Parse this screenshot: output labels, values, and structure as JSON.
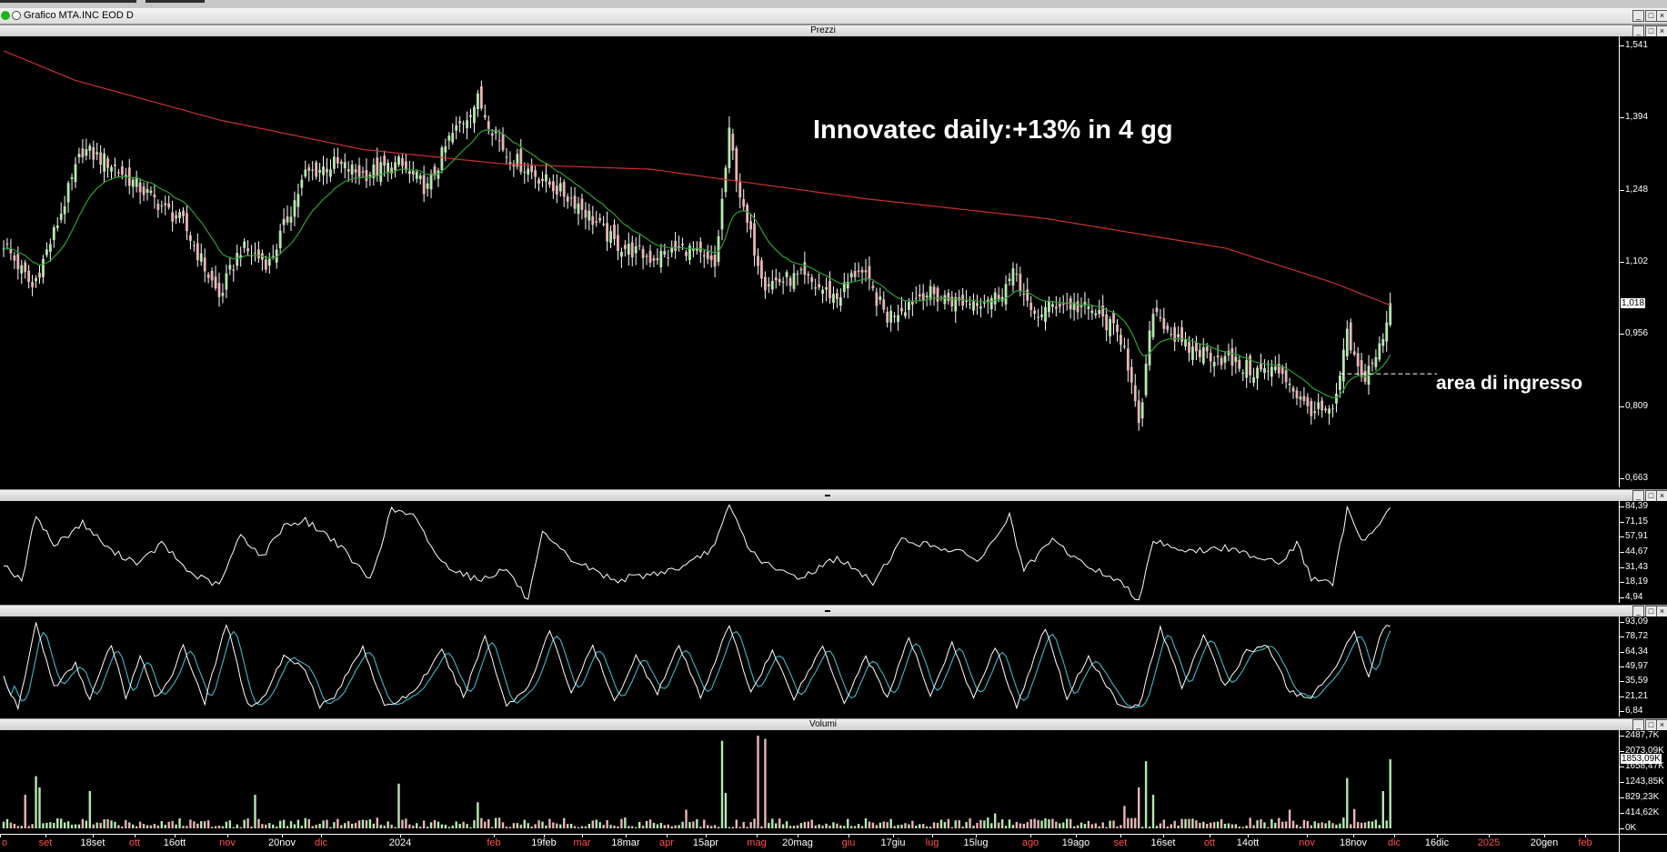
{
  "window": {
    "title": "Grafico MTA.INC EOD D"
  },
  "panels": {
    "price": {
      "title": "Prezzi"
    },
    "rsi": {
      "title": ""
    },
    "stoch": {
      "title": ""
    },
    "volume": {
      "title": "Volumi"
    }
  },
  "annotations": {
    "headline": "Innovatec daily:+13% in 4 gg",
    "entry_area": "area di ingresso"
  },
  "colors": {
    "up": "#b6e8b0",
    "down": "#e8b6b6",
    "ma_long": "#c83232",
    "ma_short": "#2fa02f",
    "stoch_k": "#ffffff",
    "stoch_d": "#3fb8c8",
    "vol_up": "#b6e8b0",
    "vol_down": "#e8b6b6"
  },
  "chart_data": [
    {
      "type": "candlestick",
      "panel": "price",
      "title": "Prezzi",
      "y_ticks": [
        "1,541",
        "1,394",
        "1,248",
        "1,102",
        "0,956",
        "0,809",
        "0,663"
      ],
      "ylim": [
        0.663,
        1.541
      ],
      "last_price_label": "1,018",
      "last_price": 1.018,
      "entry_level": 0.875,
      "x_ticks": [
        "o",
        "set",
        "18set",
        "ott",
        "16ott",
        "nov",
        "20nov",
        "dic",
        "2024",
        "feb",
        "19feb",
        "mar",
        "18mar",
        "apr",
        "15apr",
        "mag",
        "20mag",
        "giu",
        "17giu",
        "lug",
        "15lug",
        "ago",
        "19ago",
        "set",
        "16set",
        "ott",
        "14ott",
        "nov",
        "18nov",
        "dic",
        "16dic",
        "2025",
        "20gen",
        "feb"
      ],
      "x_tick_colors": [
        "#ff5050",
        "#ff5050",
        "#ffffff",
        "#ff5050",
        "#ffffff",
        "#ff5050",
        "#ffffff",
        "#ff5050",
        "#ffffff",
        "#ff5050",
        "#ffffff",
        "#ff5050",
        "#ffffff",
        "#ff5050",
        "#ffffff",
        "#ff5050",
        "#ffffff",
        "#ff5050",
        "#ffffff",
        "#ff5050",
        "#ffffff",
        "#ff5050",
        "#ffffff",
        "#ff5050",
        "#ffffff",
        "#ff5050",
        "#ffffff",
        "#ff5050",
        "#ffffff",
        "#ff5050",
        "#ffffff",
        "#ff5050",
        "#ffffff",
        "#ff5050"
      ],
      "close_anchors": [
        {
          "i": 0,
          "v": 1.14
        },
        {
          "i": 8,
          "v": 1.05
        },
        {
          "i": 14,
          "v": 1.16
        },
        {
          "i": 22,
          "v": 1.33
        },
        {
          "i": 30,
          "v": 1.3
        },
        {
          "i": 40,
          "v": 1.24
        },
        {
          "i": 50,
          "v": 1.18
        },
        {
          "i": 60,
          "v": 1.03
        },
        {
          "i": 66,
          "v": 1.13
        },
        {
          "i": 74,
          "v": 1.1
        },
        {
          "i": 84,
          "v": 1.28
        },
        {
          "i": 92,
          "v": 1.3
        },
        {
          "i": 100,
          "v": 1.28
        },
        {
          "i": 110,
          "v": 1.3
        },
        {
          "i": 118,
          "v": 1.25
        },
        {
          "i": 124,
          "v": 1.35
        },
        {
          "i": 132,
          "v": 1.43
        },
        {
          "i": 140,
          "v": 1.32
        },
        {
          "i": 150,
          "v": 1.27
        },
        {
          "i": 160,
          "v": 1.22
        },
        {
          "i": 170,
          "v": 1.14
        },
        {
          "i": 180,
          "v": 1.11
        },
        {
          "i": 190,
          "v": 1.13
        },
        {
          "i": 198,
          "v": 1.09
        },
        {
          "i": 202,
          "v": 1.36
        },
        {
          "i": 206,
          "v": 1.2
        },
        {
          "i": 212,
          "v": 1.06
        },
        {
          "i": 222,
          "v": 1.07
        },
        {
          "i": 232,
          "v": 1.03
        },
        {
          "i": 238,
          "v": 1.09
        },
        {
          "i": 246,
          "v": 0.99
        },
        {
          "i": 256,
          "v": 1.04
        },
        {
          "i": 266,
          "v": 1.02
        },
        {
          "i": 276,
          "v": 1.03
        },
        {
          "i": 282,
          "v": 1.08
        },
        {
          "i": 286,
          "v": 0.99
        },
        {
          "i": 294,
          "v": 1.02
        },
        {
          "i": 304,
          "v": 1.0
        },
        {
          "i": 312,
          "v": 0.94
        },
        {
          "i": 316,
          "v": 0.76
        },
        {
          "i": 320,
          "v": 1.01
        },
        {
          "i": 328,
          "v": 0.93
        },
        {
          "i": 338,
          "v": 0.91
        },
        {
          "i": 348,
          "v": 0.88
        },
        {
          "i": 356,
          "v": 0.88
        },
        {
          "i": 362,
          "v": 0.81
        },
        {
          "i": 370,
          "v": 0.79
        },
        {
          "i": 374,
          "v": 0.95
        },
        {
          "i": 378,
          "v": 0.86
        },
        {
          "i": 384,
          "v": 0.94
        },
        {
          "i": 386,
          "v": 1.018
        }
      ],
      "ma_long_anchors": [
        {
          "i": 0,
          "v": 1.53
        },
        {
          "i": 20,
          "v": 1.47
        },
        {
          "i": 60,
          "v": 1.39
        },
        {
          "i": 100,
          "v": 1.33
        },
        {
          "i": 140,
          "v": 1.3
        },
        {
          "i": 180,
          "v": 1.29
        },
        {
          "i": 210,
          "v": 1.26
        },
        {
          "i": 240,
          "v": 1.23
        },
        {
          "i": 290,
          "v": 1.19
        },
        {
          "i": 340,
          "v": 1.13
        },
        {
          "i": 370,
          "v": 1.06
        },
        {
          "i": 386,
          "v": 1.014
        }
      ]
    },
    {
      "type": "line",
      "panel": "rsi",
      "y_ticks": [
        "84,39",
        "71,15",
        "57,91",
        "44,67",
        "31,43",
        "18,19",
        "4,94"
      ],
      "ylim": [
        4.94,
        84.39
      ],
      "anchors": [
        {
          "i": 0,
          "v": 35
        },
        {
          "i": 5,
          "v": 18
        },
        {
          "i": 9,
          "v": 78
        },
        {
          "i": 14,
          "v": 50
        },
        {
          "i": 22,
          "v": 70
        },
        {
          "i": 30,
          "v": 45
        },
        {
          "i": 38,
          "v": 35
        },
        {
          "i": 44,
          "v": 52
        },
        {
          "i": 52,
          "v": 26
        },
        {
          "i": 60,
          "v": 15
        },
        {
          "i": 66,
          "v": 60
        },
        {
          "i": 72,
          "v": 40
        },
        {
          "i": 78,
          "v": 68
        },
        {
          "i": 84,
          "v": 72
        },
        {
          "i": 92,
          "v": 55
        },
        {
          "i": 102,
          "v": 20
        },
        {
          "i": 108,
          "v": 82
        },
        {
          "i": 114,
          "v": 76
        },
        {
          "i": 122,
          "v": 35
        },
        {
          "i": 132,
          "v": 20
        },
        {
          "i": 140,
          "v": 30
        },
        {
          "i": 146,
          "v": 2
        },
        {
          "i": 150,
          "v": 60
        },
        {
          "i": 158,
          "v": 38
        },
        {
          "i": 170,
          "v": 20
        },
        {
          "i": 180,
          "v": 25
        },
        {
          "i": 190,
          "v": 32
        },
        {
          "i": 198,
          "v": 50
        },
        {
          "i": 202,
          "v": 85
        },
        {
          "i": 208,
          "v": 45
        },
        {
          "i": 214,
          "v": 30
        },
        {
          "i": 222,
          "v": 22
        },
        {
          "i": 232,
          "v": 40
        },
        {
          "i": 242,
          "v": 18
        },
        {
          "i": 250,
          "v": 55
        },
        {
          "i": 262,
          "v": 48
        },
        {
          "i": 272,
          "v": 38
        },
        {
          "i": 280,
          "v": 76
        },
        {
          "i": 284,
          "v": 28
        },
        {
          "i": 292,
          "v": 55
        },
        {
          "i": 300,
          "v": 35
        },
        {
          "i": 310,
          "v": 20
        },
        {
          "i": 316,
          "v": 3
        },
        {
          "i": 320,
          "v": 55
        },
        {
          "i": 330,
          "v": 45
        },
        {
          "i": 340,
          "v": 48
        },
        {
          "i": 350,
          "v": 40
        },
        {
          "i": 356,
          "v": 36
        },
        {
          "i": 360,
          "v": 52
        },
        {
          "i": 364,
          "v": 22
        },
        {
          "i": 370,
          "v": 16
        },
        {
          "i": 374,
          "v": 82
        },
        {
          "i": 378,
          "v": 56
        },
        {
          "i": 382,
          "v": 64
        },
        {
          "i": 386,
          "v": 84
        }
      ]
    },
    {
      "type": "line",
      "panel": "stochastic",
      "y_ticks": [
        "93,09",
        "78,72",
        "64,34",
        "49,97",
        "35,59",
        "21,21",
        "6,84"
      ],
      "ylim": [
        6.84,
        93.09
      ],
      "k_anchors": [
        {
          "i": 0,
          "v": 40
        },
        {
          "i": 4,
          "v": 8
        },
        {
          "i": 9,
          "v": 92
        },
        {
          "i": 14,
          "v": 30
        },
        {
          "i": 20,
          "v": 52
        },
        {
          "i": 24,
          "v": 18
        },
        {
          "i": 30,
          "v": 72
        },
        {
          "i": 34,
          "v": 20
        },
        {
          "i": 38,
          "v": 60
        },
        {
          "i": 42,
          "v": 20
        },
        {
          "i": 46,
          "v": 36
        },
        {
          "i": 50,
          "v": 70
        },
        {
          "i": 56,
          "v": 15
        },
        {
          "i": 62,
          "v": 92
        },
        {
          "i": 68,
          "v": 12
        },
        {
          "i": 72,
          "v": 18
        },
        {
          "i": 78,
          "v": 60
        },
        {
          "i": 84,
          "v": 48
        },
        {
          "i": 88,
          "v": 12
        },
        {
          "i": 92,
          "v": 20
        },
        {
          "i": 100,
          "v": 70
        },
        {
          "i": 106,
          "v": 10
        },
        {
          "i": 114,
          "v": 25
        },
        {
          "i": 122,
          "v": 65
        },
        {
          "i": 128,
          "v": 20
        },
        {
          "i": 134,
          "v": 80
        },
        {
          "i": 140,
          "v": 12
        },
        {
          "i": 146,
          "v": 30
        },
        {
          "i": 152,
          "v": 85
        },
        {
          "i": 158,
          "v": 25
        },
        {
          "i": 164,
          "v": 70
        },
        {
          "i": 170,
          "v": 15
        },
        {
          "i": 176,
          "v": 60
        },
        {
          "i": 182,
          "v": 25
        },
        {
          "i": 188,
          "v": 70
        },
        {
          "i": 194,
          "v": 20
        },
        {
          "i": 202,
          "v": 90
        },
        {
          "i": 208,
          "v": 25
        },
        {
          "i": 214,
          "v": 65
        },
        {
          "i": 220,
          "v": 20
        },
        {
          "i": 228,
          "v": 70
        },
        {
          "i": 234,
          "v": 15
        },
        {
          "i": 240,
          "v": 60
        },
        {
          "i": 246,
          "v": 20
        },
        {
          "i": 252,
          "v": 78
        },
        {
          "i": 258,
          "v": 22
        },
        {
          "i": 264,
          "v": 72
        },
        {
          "i": 270,
          "v": 18
        },
        {
          "i": 276,
          "v": 70
        },
        {
          "i": 282,
          "v": 10
        },
        {
          "i": 290,
          "v": 88
        },
        {
          "i": 296,
          "v": 20
        },
        {
          "i": 302,
          "v": 60
        },
        {
          "i": 310,
          "v": 15
        },
        {
          "i": 316,
          "v": 10
        },
        {
          "i": 322,
          "v": 88
        },
        {
          "i": 328,
          "v": 30
        },
        {
          "i": 334,
          "v": 80
        },
        {
          "i": 340,
          "v": 30
        },
        {
          "i": 346,
          "v": 65
        },
        {
          "i": 352,
          "v": 70
        },
        {
          "i": 358,
          "v": 25
        },
        {
          "i": 364,
          "v": 20
        },
        {
          "i": 370,
          "v": 45
        },
        {
          "i": 376,
          "v": 85
        },
        {
          "i": 380,
          "v": 40
        },
        {
          "i": 384,
          "v": 88
        },
        {
          "i": 386,
          "v": 90
        }
      ]
    },
    {
      "type": "bar",
      "panel": "volume",
      "title": "Volumi",
      "y_ticks": [
        "2487,7K",
        "2073,09K",
        "1658,47K",
        "1243,85K",
        "829,23K",
        "414,62K",
        "0K"
      ],
      "ylim": [
        0,
        2487.7
      ],
      "last_value_label": "1853,09K",
      "last_value": 1853.09,
      "spikes": [
        {
          "i": 6,
          "v": 900
        },
        {
          "i": 9,
          "v": 1400
        },
        {
          "i": 10,
          "v": 1100
        },
        {
          "i": 24,
          "v": 1000
        },
        {
          "i": 70,
          "v": 900
        },
        {
          "i": 110,
          "v": 1200
        },
        {
          "i": 132,
          "v": 700
        },
        {
          "i": 190,
          "v": 500
        },
        {
          "i": 200,
          "v": 2350
        },
        {
          "i": 201,
          "v": 950
        },
        {
          "i": 210,
          "v": 2487
        },
        {
          "i": 212,
          "v": 2400
        },
        {
          "i": 276,
          "v": 400
        },
        {
          "i": 312,
          "v": 600
        },
        {
          "i": 316,
          "v": 1100
        },
        {
          "i": 318,
          "v": 1800
        },
        {
          "i": 320,
          "v": 900
        },
        {
          "i": 358,
          "v": 500
        },
        {
          "i": 374,
          "v": 1350
        },
        {
          "i": 376,
          "v": 520
        },
        {
          "i": 384,
          "v": 1000
        },
        {
          "i": 386,
          "v": 1853
        }
      ]
    }
  ]
}
